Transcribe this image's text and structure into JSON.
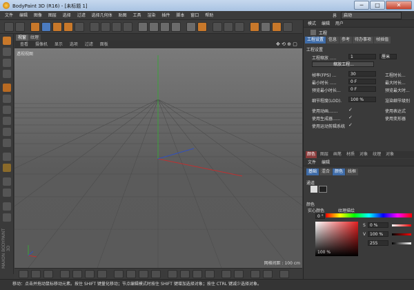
{
  "window": {
    "title": "BodyPaint 3D (R16) - [未标题 1]",
    "min": "─",
    "max": "□",
    "close": "✕"
  },
  "menu": [
    "文件",
    "编辑",
    "图像",
    "图层",
    "选择",
    "过滤",
    "选择几何体",
    "贴图",
    "工具",
    "渲染",
    "插件",
    "脚本",
    "窗口",
    "帮助"
  ],
  "layout": {
    "label": "界面:",
    "value": "启动"
  },
  "viewport": {
    "tabs": [
      "视窗",
      "纹理"
    ],
    "menu": [
      "查看",
      "摄像机",
      "显示",
      "选项",
      "过滤",
      "面板"
    ],
    "label": "透视视图",
    "nav_icons": "✥ ⟲ ⊕ ▢",
    "grid_label": "网格间距 : 100 cm"
  },
  "brand": "MAXON BODYPAINT 3D",
  "status": "移动：点击并拖动鼠标移动元素。按住 SHIFT 键量化移动；节点编辑模式时按住 SHIFT 键增加选择对象；按住 CTRL 键减少选择对象。",
  "right_panel": {
    "top_tabs": [
      "模式",
      "编辑",
      "用户"
    ],
    "object_name": "工程",
    "attr_tabs": [
      "工程设置",
      "信息",
      "参考",
      "待办事项",
      "帧插值"
    ],
    "section": "工程设置",
    "fields": {
      "scale_label": "工程缩放 .....",
      "scale_value": "1",
      "scale_unit": "厘米",
      "scale_button": "缩放工程...",
      "fps_label": "帧率(FPS) ...",
      "fps_value": "30",
      "min_time_label": "最小时长 .....",
      "min_time_value": "0 F",
      "preview_min_label": "预览最小时长...",
      "preview_min_value": "0 F",
      "project_time_label": "工程时长...",
      "max_time_label": "最大时长...",
      "preview_max_label": "预览最大时...",
      "lod_label": "细节程度(LOD).",
      "lod_value": "100 %",
      "render_lod_label": "渲染细节级别",
      "use_anim": "使用动画.......",
      "use_generator": "使用生成器......",
      "use_motion": "使用运动剪辑系统",
      "use_expr": "使用表达式",
      "use_deform": "使用变形器"
    },
    "mat_tabs": [
      "颜色",
      "图层",
      "画笔",
      "材质",
      "对象",
      "纹理",
      "对象"
    ],
    "mat_menu": [
      "文件",
      "编辑"
    ],
    "mat_subtabs": [
      "基础",
      "混合",
      "颜色",
      "线框"
    ],
    "channel_title": "通道",
    "color_title": "颜色",
    "color_options": [
      "实心颜色",
      "纹理描绘"
    ],
    "hue_value": "0 °",
    "s_label": "S",
    "s_value": "0 %",
    "v_label": "V",
    "v_value": "100 %",
    "alpha_value": "255",
    "bottom_value": "100 %",
    "accent": "#3f6ca8"
  }
}
